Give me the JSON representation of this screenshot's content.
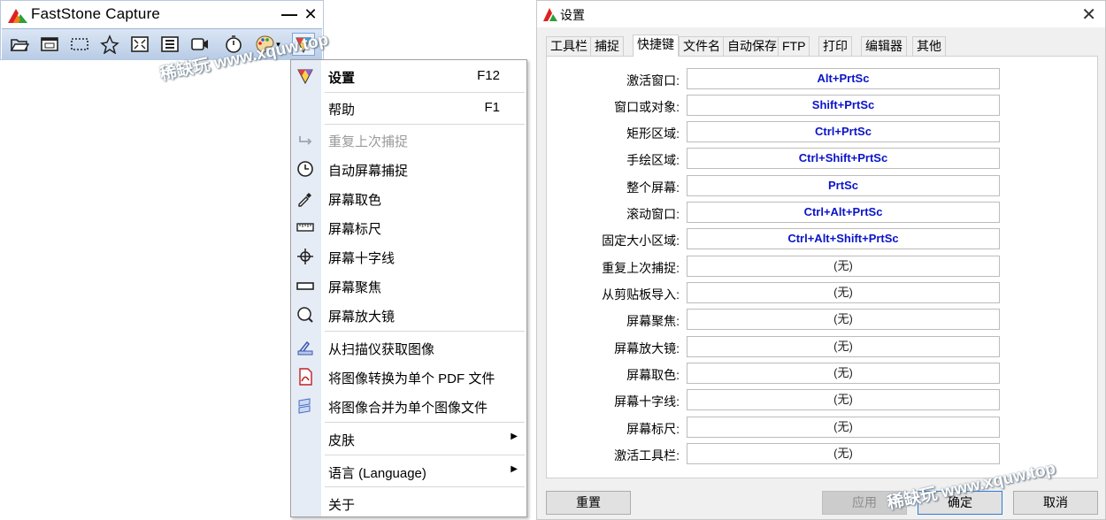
{
  "faststone": {
    "title": "FastStone Capture",
    "min_glyph": "—",
    "close_glyph": "✕",
    "toolbar": [
      {
        "icon": "open-folder-icon"
      },
      {
        "icon": "capture-window-icon"
      },
      {
        "icon": "capture-rectangle-icon"
      },
      {
        "icon": "capture-freehand-icon"
      },
      {
        "icon": "capture-fullscreen-icon"
      },
      {
        "icon": "capture-scrolling-icon"
      },
      {
        "icon": "screen-recorder-icon"
      },
      {
        "icon": "delay-timer-icon"
      },
      {
        "icon": "output-palette-icon"
      },
      {
        "icon": "settings-menu-icon"
      }
    ]
  },
  "menu": {
    "items": [
      {
        "label": "设置",
        "key": "F12",
        "icon": "settings-icon"
      },
      {
        "label": "帮助",
        "key": "F1"
      },
      {
        "label": "重复上次捕捉",
        "icon": "repeat-icon",
        "disabled": true
      },
      {
        "label": "自动屏幕捕捉",
        "icon": "clock-icon"
      },
      {
        "label": "屏幕取色",
        "icon": "color-picker-icon"
      },
      {
        "label": "屏幕标尺",
        "icon": "ruler-icon"
      },
      {
        "label": "屏幕十字线",
        "icon": "crosshair-icon"
      },
      {
        "label": "屏幕聚焦",
        "icon": "focus-icon"
      },
      {
        "label": "屏幕放大镜",
        "icon": "magnifier-icon"
      },
      {
        "label": "从扫描仪获取图像",
        "icon": "scanner-icon"
      },
      {
        "label": "将图像转换为单个 PDF 文件",
        "icon": "pdf-icon"
      },
      {
        "label": "将图像合并为单个图像文件",
        "icon": "merge-images-icon"
      },
      {
        "label": "皮肤",
        "submenu": true
      },
      {
        "label": "语言 (Language)",
        "submenu": true
      },
      {
        "label": "关于"
      }
    ],
    "submenu_arrow": "▶"
  },
  "settings": {
    "title": "设置",
    "close_glyph": "✕",
    "tabs": [
      "工具栏",
      "捕捉",
      "快捷键",
      "文件名",
      "自动保存",
      "FTP",
      "打印",
      "编辑器",
      "其他"
    ],
    "active_tab": "快捷键",
    "hotkeys": [
      {
        "label": "激活窗口:",
        "value": "Alt+PrtSc"
      },
      {
        "label": "窗口或对象:",
        "value": "Shift+PrtSc"
      },
      {
        "label": "矩形区域:",
        "value": "Ctrl+PrtSc"
      },
      {
        "label": "手绘区域:",
        "value": "Ctrl+Shift+PrtSc"
      },
      {
        "label": "整个屏幕:",
        "value": "PrtSc"
      },
      {
        "label": "滚动窗口:",
        "value": "Ctrl+Alt+PrtSc"
      },
      {
        "label": "固定大小区域:",
        "value": "Ctrl+Alt+Shift+PrtSc"
      },
      {
        "label": "重复上次捕捉:",
        "value": "(无)"
      },
      {
        "label": "从剪贴板导入:",
        "value": "(无)"
      },
      {
        "label": "屏幕聚焦:",
        "value": "(无)"
      },
      {
        "label": "屏幕放大镜:",
        "value": "(无)"
      },
      {
        "label": "屏幕取色:",
        "value": "(无)"
      },
      {
        "label": "屏幕十字线:",
        "value": "(无)"
      },
      {
        "label": "屏幕标尺:",
        "value": "(无)"
      },
      {
        "label": "激活工具栏:",
        "value": "(无)"
      }
    ],
    "buttons": {
      "reset": "重置",
      "apply": "应用",
      "ok": "确定",
      "cancel": "取消"
    }
  },
  "watermarks": [
    "稀缺玩 www.xquw.top",
    "稀缺玩 www.xquw.top"
  ],
  "colors": {
    "hotkey_set": "#0a14c8",
    "toolbar_bg": "#c8d8ee",
    "menu_gutter": "#e6ecf6"
  }
}
